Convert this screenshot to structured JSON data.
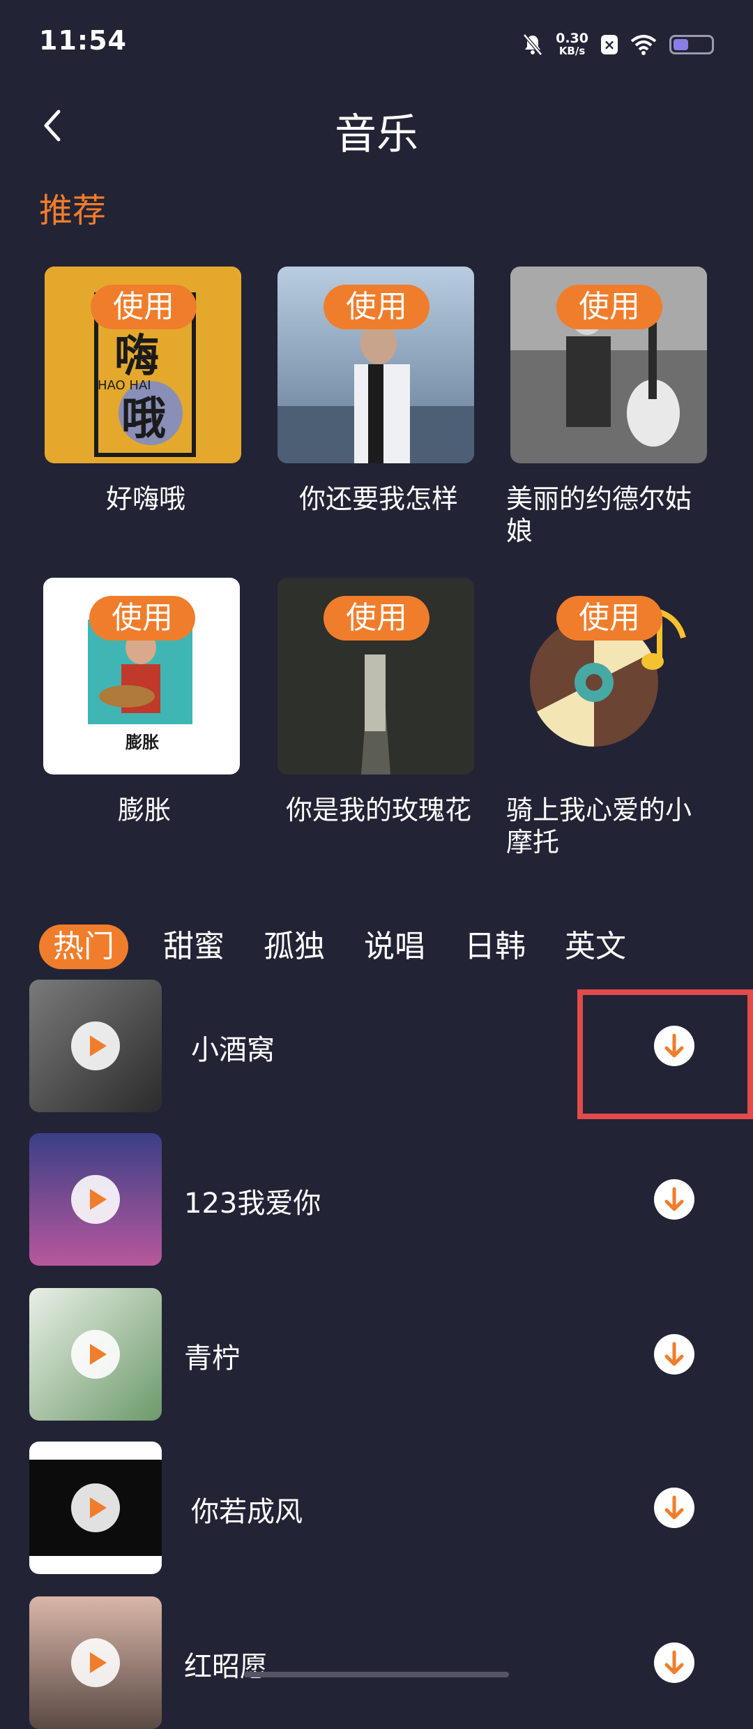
{
  "status_bar": {
    "time": "11:54",
    "net_speed": "0.30",
    "net_unit": "KB/s",
    "x_badge": "×",
    "battery_level": 0.4
  },
  "header": {
    "title": "音乐"
  },
  "recommend": {
    "title": "推荐",
    "use_label": "使用",
    "items": [
      {
        "name": "好嗨哦",
        "cover_text": "嗨\n哦"
      },
      {
        "name": "你还要我怎样"
      },
      {
        "name": "美丽的约德尔姑娘"
      },
      {
        "name": "膨胀"
      },
      {
        "name": "你是我的玫瑰花"
      },
      {
        "name": "骑上我心爱的小摩托"
      }
    ]
  },
  "tabs": [
    "热门",
    "甜蜜",
    "孤独",
    "说唱",
    "日韩",
    "英文"
  ],
  "songs": [
    {
      "name": "小酒窝"
    },
    {
      "name": "123我爱你"
    },
    {
      "name": "青柠"
    },
    {
      "name": "你若成风"
    },
    {
      "name": "红昭愿"
    }
  ],
  "colors": {
    "accent": "#f07d2b",
    "background": "#232336",
    "highlight": "#e24b4b"
  }
}
